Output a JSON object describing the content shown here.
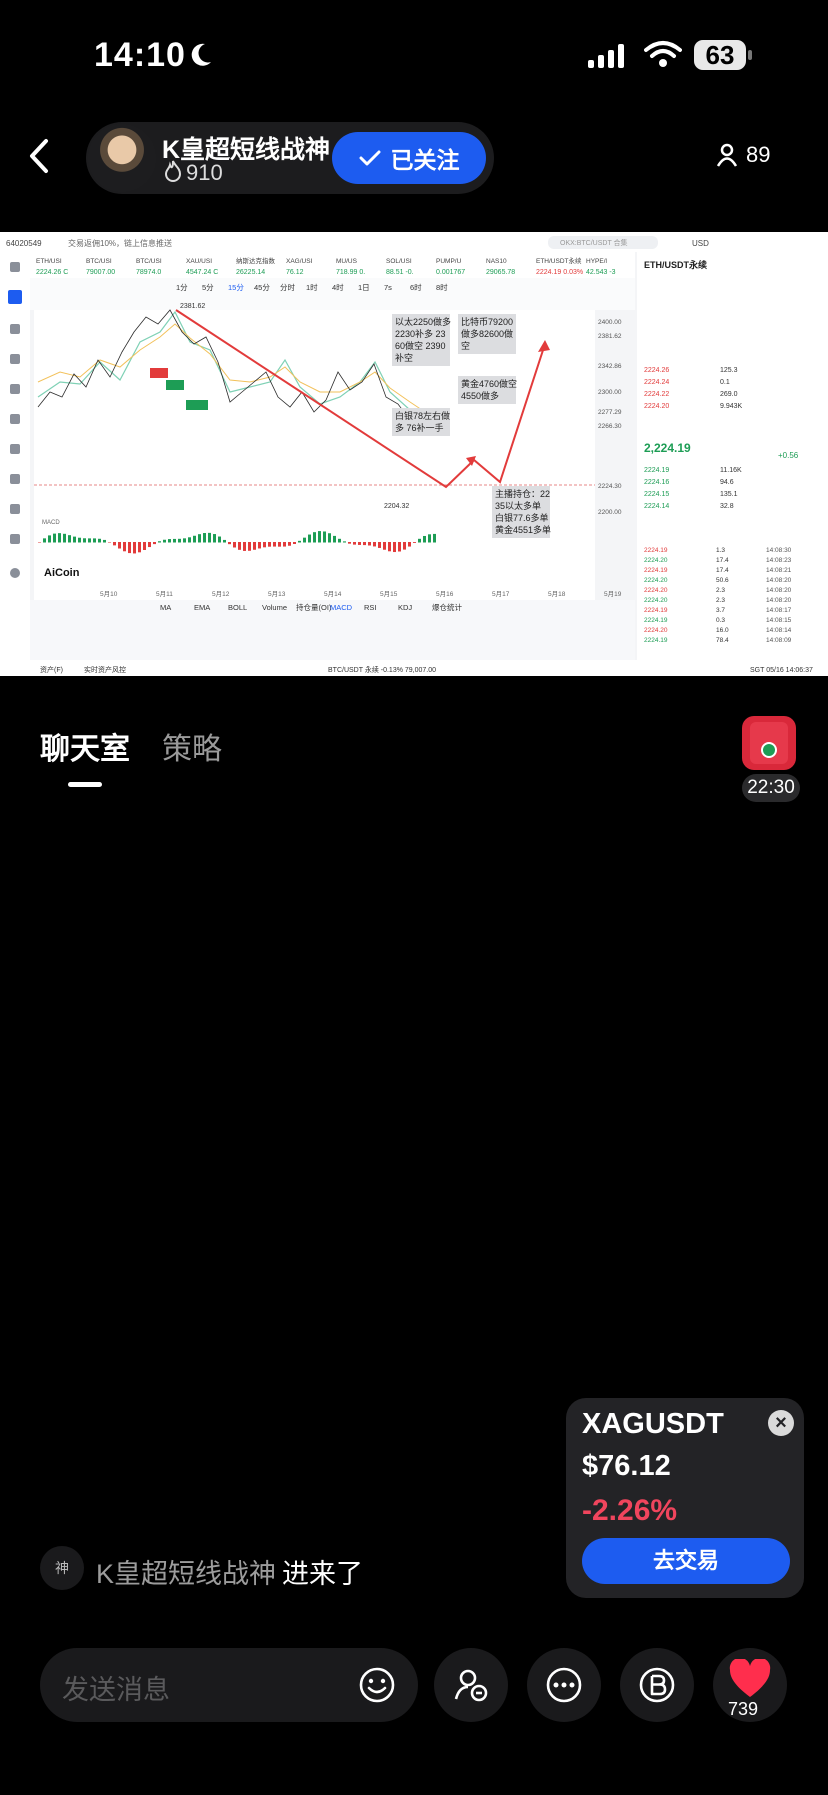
{
  "status_bar": {
    "time": "14:10",
    "battery": "63"
  },
  "header": {
    "host_name": "K皇超短线战神",
    "host_heat": "910",
    "follow_label": "已关注",
    "viewer_count": "89"
  },
  "stream": {
    "window_id": "64020549",
    "top_notice": "交易返佣10%，链上信息推送",
    "search_placeholder": "OKX:BTC/USDT 合集",
    "currency": "USD",
    "tickers": [
      {
        "sym": "ETH/USI",
        "val": "2224.26 C"
      },
      {
        "sym": "BTC/USI",
        "val": "79007.00"
      },
      {
        "sym": "BTC/USI",
        "val": "78974.0"
      },
      {
        "sym": "XAU/USI",
        "val": "4547.24 C"
      },
      {
        "sym": "纳斯达克指数",
        "val": "26225.14"
      },
      {
        "sym": "XAG/USI",
        "val": "76.12"
      },
      {
        "sym": "MU/US",
        "val": "718.99 0."
      },
      {
        "sym": "SOL/USI",
        "val": "88.51 -0."
      },
      {
        "sym": "PUMP/U",
        "val": "0.001767"
      },
      {
        "sym": "NAS10",
        "val": "29065.78"
      },
      {
        "sym": "ETH/USDT永续",
        "val": "2224.19 0.03%"
      },
      {
        "sym": "HYPE/l",
        "val": "42.543 -3"
      }
    ],
    "intervals": [
      "1分",
      "5分",
      "15分",
      "45分",
      "分时",
      "1时",
      "4时",
      "1日",
      "7s",
      "6时",
      "8时"
    ],
    "high_label": "2381.62",
    "low_label": "2204.32",
    "dates": [
      "5月10",
      "5月11",
      "5月12",
      "5月13",
      "5月14",
      "5月15",
      "5月16",
      "5月17",
      "5月18",
      "5月19"
    ],
    "y_ticks": [
      "2400.00",
      "2381.62",
      "2342.86",
      "2300.00",
      "2277.29",
      "2266.30",
      "2224.30",
      "2200.00"
    ],
    "annotations": [
      "以太2250做多\n2230补多 23\n60做空 2390\n补空",
      "比特币79200\n做多82600做\n空",
      "黄金4760做空\n4550做多",
      "白银78左右做\n多 76补一手",
      "主播持仓：22\n35以太多单\n白银77.6多单\n黄金4551多单"
    ],
    "indicator_tabs": [
      "MA",
      "EMA",
      "BOLL",
      "Volume",
      "持仓量(OI)",
      "MACD",
      "RSI",
      "KDJ",
      "爆仓统计"
    ],
    "bottom_tabs": [
      "资产(F)",
      "实时资产风控"
    ],
    "bottom_ticker": "BTC/USDT 永续  -0.13%  79,007.00",
    "clock": "SGT 05/16 14:06:37",
    "logo": "AiCoin",
    "right_panel": {
      "title": "ETH/USDT永续",
      "price": "2,224.19",
      "change": "+0.56",
      "asks": [
        [
          "2224.26",
          "125.3"
        ],
        [
          "2224.24",
          "0.1"
        ],
        [
          "2224.22",
          "269.0"
        ],
        [
          "2224.20",
          "9.943K"
        ]
      ],
      "bids": [
        [
          "2224.19",
          "11.16K"
        ],
        [
          "2224.16",
          "94.6"
        ],
        [
          "2224.15",
          "135.1"
        ],
        [
          "2224.14",
          "32.8"
        ]
      ],
      "trades": [
        [
          "2224.19",
          "1.3",
          "14:08:30"
        ],
        [
          "2224.20",
          "17.4",
          "14:08:23"
        ],
        [
          "2224.19",
          "17.4",
          "14:08:21"
        ],
        [
          "2224.20",
          "50.6",
          "14:08:20"
        ],
        [
          "2224.20",
          "2.3",
          "14:08:20"
        ],
        [
          "2224.20",
          "2.3",
          "14:08:20"
        ],
        [
          "2224.19",
          "3.7",
          "14:08:17"
        ],
        [
          "2224.19",
          "0.3",
          "14:08:15"
        ],
        [
          "2224.20",
          "16.0",
          "14:08:14"
        ],
        [
          "2224.19",
          "78.4",
          "14:08:09"
        ]
      ]
    }
  },
  "tabs": {
    "chat": "聊天室",
    "strategy": "策略"
  },
  "gift": {
    "timer": "22:30"
  },
  "ticker_card": {
    "symbol": "XAGUSDT",
    "price": "$76.12",
    "change": "-2.26%",
    "trade_label": "去交易"
  },
  "join_message": {
    "badge": "神",
    "name": "K皇超短线战神",
    "text": "进来了"
  },
  "bottom_bar": {
    "input_placeholder": "发送消息",
    "like_count": "739"
  },
  "colors": {
    "accent": "#1d5cf0",
    "down": "#f0455d",
    "background": "#000000"
  }
}
